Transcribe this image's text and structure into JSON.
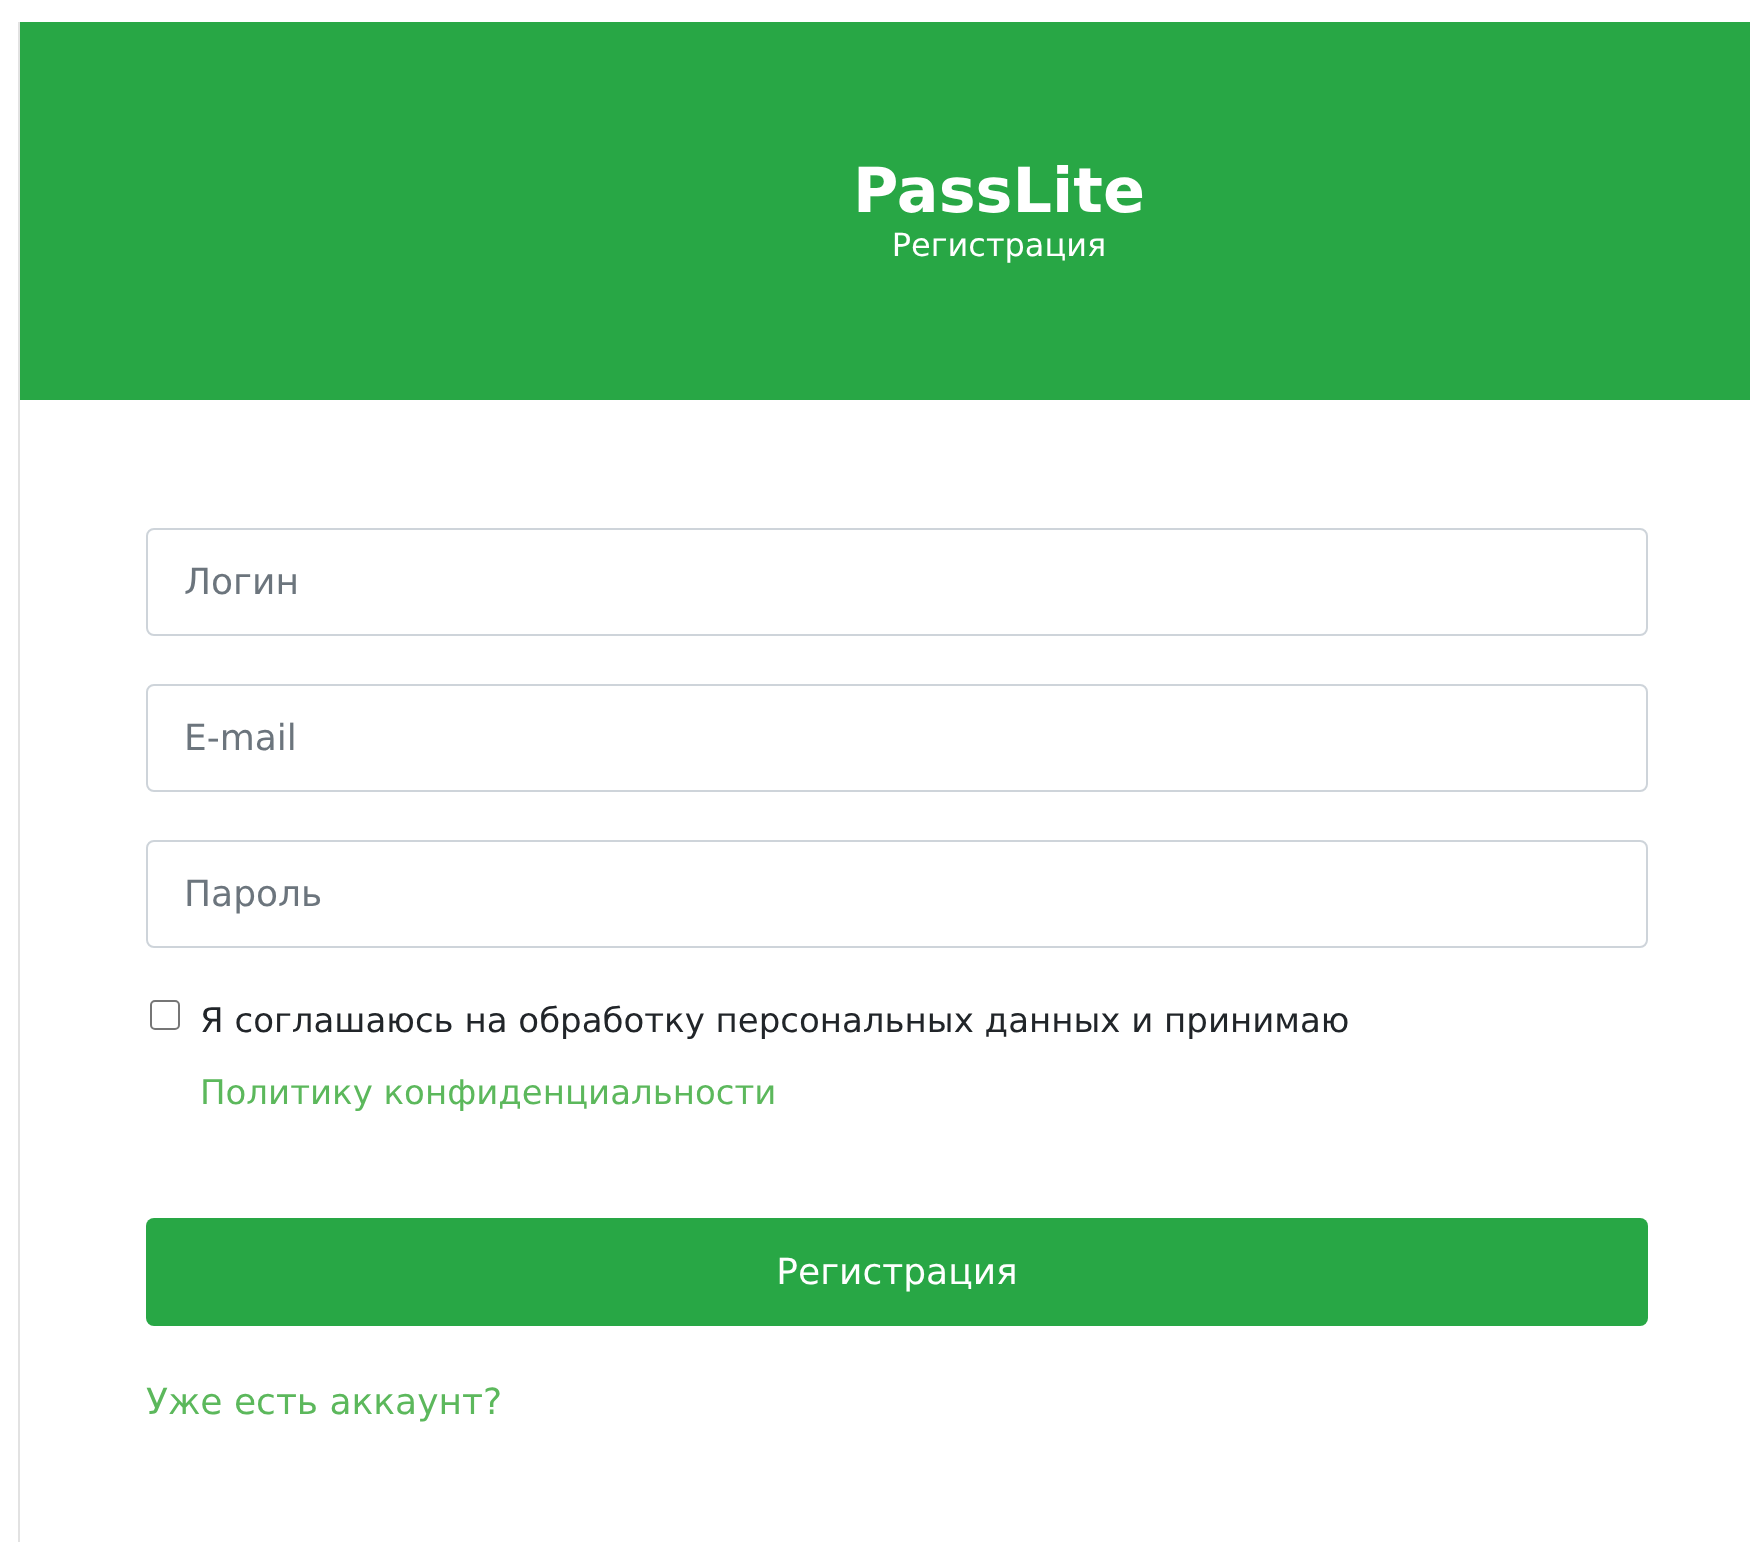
{
  "header": {
    "title": "PassLite",
    "subtitle": "Регистрация"
  },
  "fields": [
    {
      "placeholder": "Логин"
    },
    {
      "placeholder": "E-mail"
    },
    {
      "placeholder": "Пароль"
    }
  ],
  "consent": {
    "checked": false,
    "text": "Я соглашаюсь на обработку персональных данных и принимаю",
    "link": "Политику конфиденциальности"
  },
  "submit_button": "Регистрация",
  "login_link": "Уже есть аккаунт?"
}
